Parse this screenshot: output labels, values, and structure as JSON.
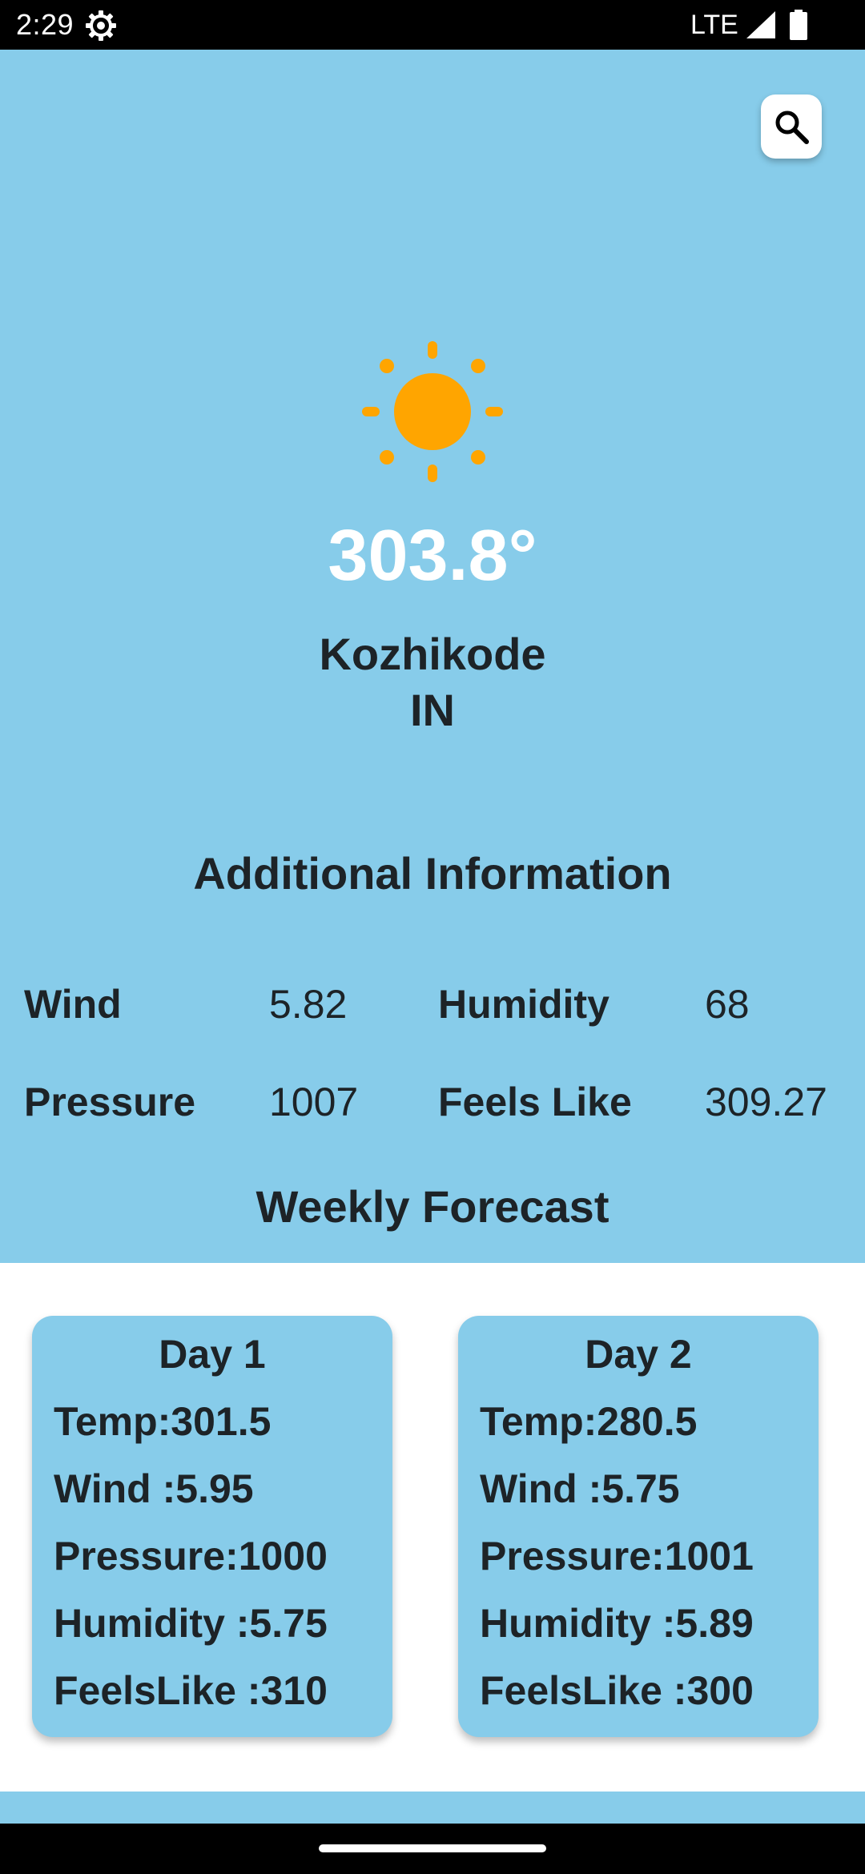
{
  "status_bar": {
    "time": "2:29",
    "network": "LTE",
    "icons": [
      "gear-icon",
      "signal-icon",
      "battery-icon"
    ]
  },
  "header": {
    "search_icon": "search-icon"
  },
  "current": {
    "weather_icon": "sun-icon",
    "temperature": "303.8°",
    "city": "Kozhikode",
    "country": "IN"
  },
  "additional_info": {
    "title": "Additional Information",
    "wind_label": "Wind",
    "wind_value": "5.82",
    "humidity_label": "Humidity",
    "humidity_value": "68",
    "pressure_label": "Pressure",
    "pressure_value": "1007",
    "feels_like_label": "Feels Like",
    "feels_like_value": "309.27"
  },
  "weekly_forecast": {
    "title": "Weekly Forecast",
    "days": [
      {
        "title": "Day 1",
        "temp": "Temp:301.5",
        "wind": "Wind :5.95",
        "pressure": "Pressure:1000",
        "humidity": "Humidity :5.75",
        "feels_like": "FeelsLike :310"
      },
      {
        "title": "Day 2",
        "temp": "Temp:280.5",
        "wind": "Wind :5.75",
        "pressure": "Pressure:1001",
        "humidity": "Humidity :5.89",
        "feels_like": "FeelsLike :300"
      }
    ]
  },
  "colors": {
    "background": "#87CCEA",
    "card": "#87CCEA",
    "text_dark": "#1d2327",
    "temperature_text": "#FFFFFF",
    "sun": "#FFA500"
  }
}
